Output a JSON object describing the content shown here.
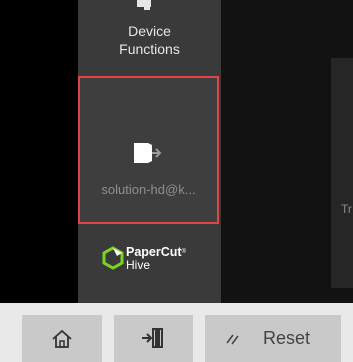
{
  "sidebar": {
    "device_functions_label": "Device\nFunctions",
    "logout_tile": {
      "user_label": "solution-hd@k...",
      "icon": "logout-icon"
    },
    "brand": {
      "name": "PaperCut",
      "sub": "Hive"
    }
  },
  "right_panel": {
    "cut_text": "Tr"
  },
  "bottom_bar": {
    "home_icon": "home-icon",
    "logout_icon": "logout-icon",
    "reset_icon": "slash-icon",
    "reset_label": "Reset"
  },
  "colors": {
    "sidebar_bg": "#3a3a3a",
    "highlight_border": "#e04545",
    "bottom_bar_bg": "#e9e9e9",
    "button_bg": "#c9c9c9",
    "brand_green": "#7ed321"
  }
}
